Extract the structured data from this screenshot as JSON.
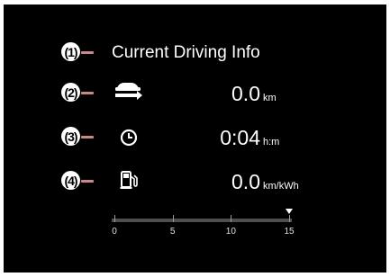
{
  "header": {
    "title": "Current Driving Info"
  },
  "callouts": [
    "(1)",
    "(2)",
    "(3)",
    "(4)"
  ],
  "rows": [
    {
      "icon": "car-distance-icon",
      "value": "0.0",
      "unit": "km"
    },
    {
      "icon": "clock-icon",
      "value": "0:04",
      "unit": "h:m"
    },
    {
      "icon": "fuel-pump-icon",
      "value": "0.0",
      "unit": "km/kWh"
    }
  ],
  "gauge": {
    "ticks": [
      "0",
      "5",
      "10",
      "15"
    ],
    "min": 0,
    "max": 15,
    "marker_value": 15
  },
  "colors": {
    "screen_bg": "#000000",
    "leader_line": "#c9888c",
    "text": "#ffffff",
    "track": "#4f4f4f"
  }
}
